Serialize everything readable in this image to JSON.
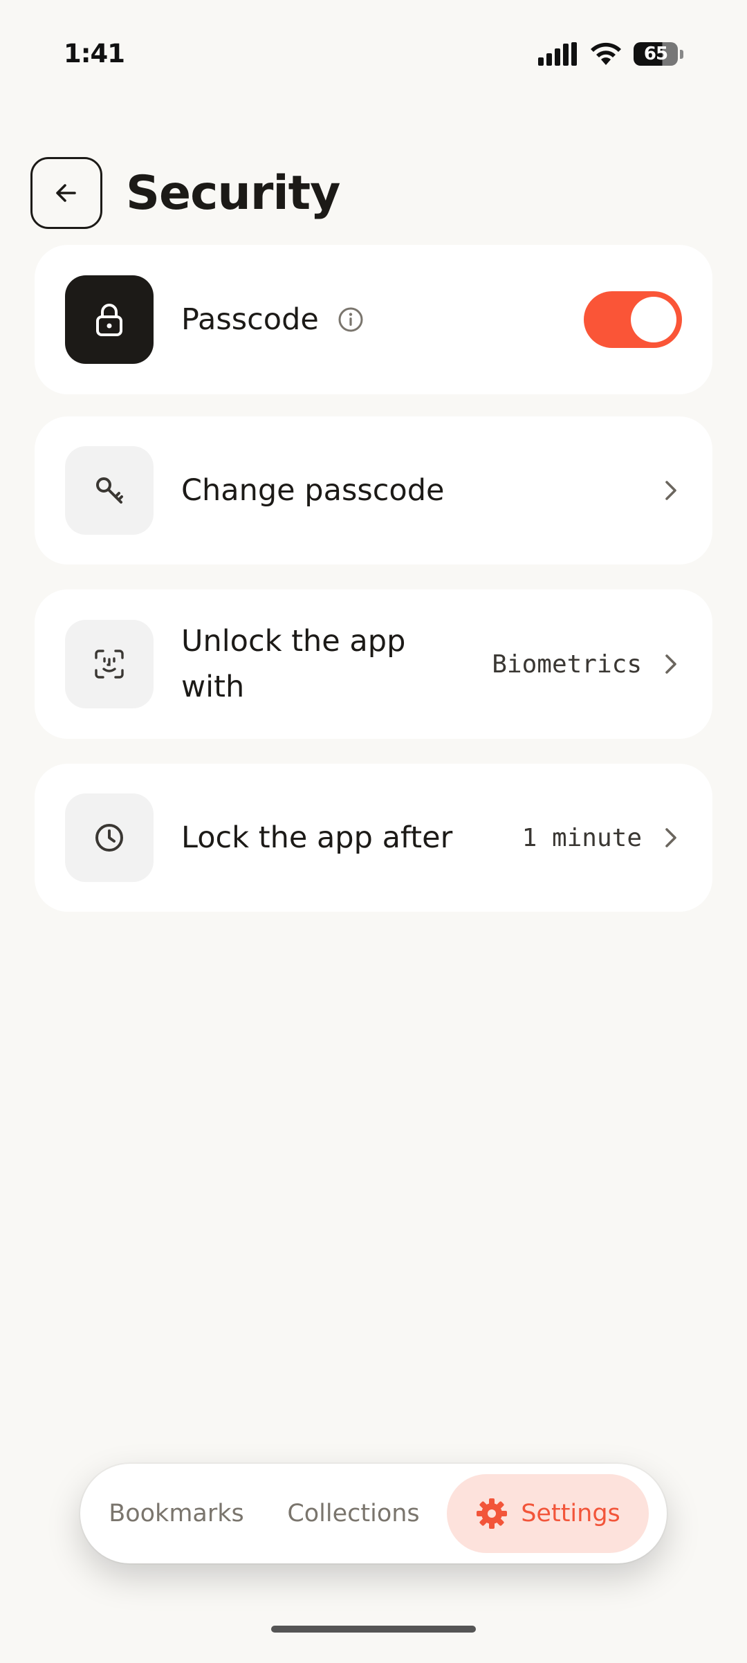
{
  "status_bar": {
    "time": "1:41",
    "battery_level": "65",
    "icons": [
      "signal-icon",
      "wifi-icon",
      "battery-icon"
    ]
  },
  "header": {
    "title": "Security",
    "back_icon": "arrow-left-icon"
  },
  "settings": {
    "passcode": {
      "label": "Passcode",
      "icon": "lock-icon",
      "info_icon": "info-icon",
      "enabled": true
    },
    "change_passcode": {
      "label": "Change passcode",
      "icon": "key-icon"
    },
    "unlock_with": {
      "label": "Unlock the app with",
      "value": "Biometrics",
      "icon": "face-id-icon"
    },
    "lock_after": {
      "label": "Lock the app after",
      "value": "1 minute",
      "icon": "clock-icon"
    }
  },
  "bottom_nav": {
    "items": [
      {
        "label": "Bookmarks",
        "active": false
      },
      {
        "label": "Collections",
        "active": false
      },
      {
        "label": "Settings",
        "active": true,
        "icon": "gear-icon"
      }
    ]
  },
  "colors": {
    "background": "#f9f8f5",
    "card": "#ffffff",
    "accent": "#fa5537",
    "accent_soft": "#fde2dc",
    "text_primary": "#1c1a17",
    "text_muted": "#7a756d"
  }
}
